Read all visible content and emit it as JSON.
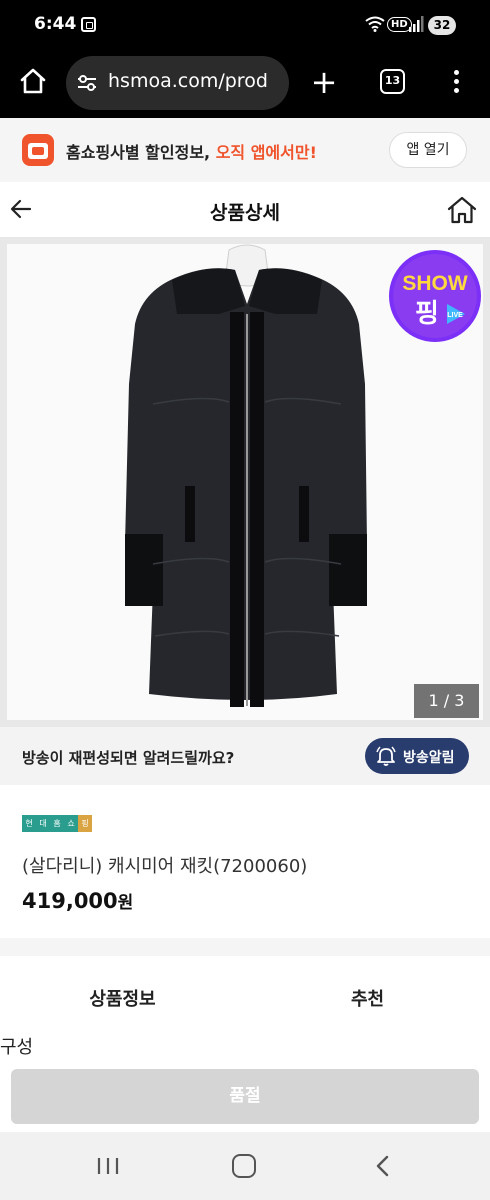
{
  "status_bar": {
    "time": "6:44",
    "hd_label": "HD",
    "battery": "32"
  },
  "browser": {
    "url": "hsmoa.com/prod",
    "new_tab_label": "+",
    "tab_count": "13"
  },
  "app_banner": {
    "text_main": "홈쇼핑사별 할인정보, ",
    "text_highlight": "오직 앱에서만!",
    "button_label": "앱 열기",
    "accent_color": "#f0542c"
  },
  "header": {
    "title": "상품상세"
  },
  "image": {
    "badge_text_top": "SHOW",
    "badge_text_bottom": "핑",
    "badge_text_live": "LIVE",
    "counter": "1 / 3"
  },
  "notify": {
    "text": "방송이 재편성되면 알려드릴까요?",
    "button_label": "방송알림",
    "button_color": "#283c6e"
  },
  "product": {
    "shop_tag": [
      "현",
      "대",
      "홈",
      "쇼",
      "핑"
    ],
    "name": "(살다리니) 캐시미어 재킷(7200060)",
    "price": "419,000",
    "price_unit": "원"
  },
  "tabs": [
    {
      "label": "상품정보"
    },
    {
      "label": "추천"
    }
  ],
  "section": {
    "label": "구성"
  },
  "buy_button": {
    "label": "품절"
  }
}
